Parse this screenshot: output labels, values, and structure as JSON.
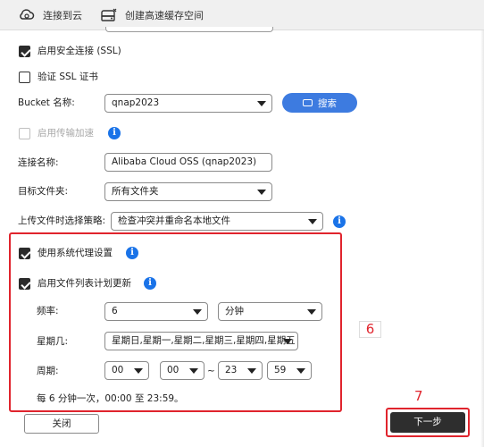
{
  "wizard_steps": [
    {
      "label": "连接到云",
      "icon": "cloud-link-icon"
    },
    {
      "label": "创建高速缓存空间",
      "icon": "cache-storage-icon"
    }
  ],
  "options": {
    "ssl_label": "启用安全连接 (SSL)",
    "ssl_checked": true,
    "verify_ssl_label": "验证 SSL 证书",
    "verify_ssl_checked": false
  },
  "bucket": {
    "label": "Bucket 名称:",
    "value": "qnap2023",
    "search_label": "搜索"
  },
  "acceleration": {
    "label": "启用传输加速",
    "checked": false,
    "disabled": true
  },
  "connection": {
    "label": "连接名称:",
    "value": "Alibaba Cloud OSS (qnap2023)"
  },
  "target_folder": {
    "label": "目标文件夹:",
    "value": "所有文件夹"
  },
  "upload_policy": {
    "label": "上传文件时选择策略:",
    "value": "检查冲突并重命名本地文件"
  },
  "proxy": {
    "label": "使用系统代理设置",
    "checked": true
  },
  "schedule": {
    "label": "启用文件列表计划更新",
    "checked": true,
    "frequency_label": "频率:",
    "frequency_value": "6",
    "frequency_unit": "分钟",
    "weekday_label": "星期几:",
    "weekday_value": "星期日,星期一,星期二,星期三,星期四,星期五",
    "period_label": "周期:",
    "start_hour": "00",
    "start_minute": "00",
    "range_separator": "~",
    "end_hour": "23",
    "end_minute": "59",
    "summary": "每 6 分钟一次，00:00 至 23:59。"
  },
  "annotations": {
    "step6": "6",
    "step7": "7"
  },
  "footer": {
    "close_label": "关闭",
    "next_label": "下一步"
  },
  "colors": {
    "accent": "#3d7be0",
    "highlight": "#e0242d",
    "info": "#1a73e8",
    "primary_button": "#2e2e2e"
  }
}
